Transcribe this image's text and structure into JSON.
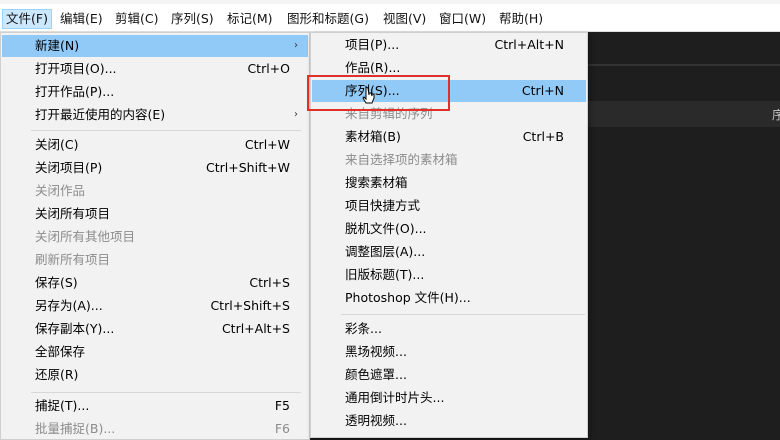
{
  "menubar": {
    "items": [
      {
        "label": "文件(F)"
      },
      {
        "label": "编辑(E)"
      },
      {
        "label": "剪辑(C)"
      },
      {
        "label": "序列(S)"
      },
      {
        "label": "标记(M)"
      },
      {
        "label": "图形和标题(G)"
      },
      {
        "label": "视图(V)"
      },
      {
        "label": "窗口(W)"
      },
      {
        "label": "帮助(H)"
      }
    ]
  },
  "file_menu": {
    "items": [
      {
        "label": "新建(N)",
        "shortcut": "",
        "submenu_arrow": "›"
      },
      {
        "label": "打开项目(O)...",
        "shortcut": "Ctrl+O"
      },
      {
        "label": "打开作品(P)...",
        "shortcut": ""
      },
      {
        "label": "打开最近使用的内容(E)",
        "shortcut": "",
        "submenu_arrow": "›"
      },
      {
        "label": "关闭(C)",
        "shortcut": "Ctrl+W"
      },
      {
        "label": "关闭项目(P)",
        "shortcut": "Ctrl+Shift+W"
      },
      {
        "label": "关闭作品",
        "shortcut": ""
      },
      {
        "label": "关闭所有项目",
        "shortcut": ""
      },
      {
        "label": "关闭所有其他项目",
        "shortcut": ""
      },
      {
        "label": "刷新所有项目",
        "shortcut": ""
      },
      {
        "label": "保存(S)",
        "shortcut": "Ctrl+S"
      },
      {
        "label": "另存为(A)...",
        "shortcut": "Ctrl+Shift+S"
      },
      {
        "label": "保存副本(Y)...",
        "shortcut": "Ctrl+Alt+S"
      },
      {
        "label": "全部保存",
        "shortcut": ""
      },
      {
        "label": "还原(R)",
        "shortcut": ""
      },
      {
        "label": "捕捉(T)...",
        "shortcut": "F5"
      },
      {
        "label": "批量捕捉(B)...",
        "shortcut": "F6"
      }
    ]
  },
  "new_submenu": {
    "items": [
      {
        "label": "项目(P)...",
        "shortcut": "Ctrl+Alt+N"
      },
      {
        "label": "作品(R)...",
        "shortcut": ""
      },
      {
        "label": "序列(S)...",
        "shortcut": "Ctrl+N"
      },
      {
        "label": "来自剪辑的序列",
        "shortcut": ""
      },
      {
        "label": "素材箱(B)",
        "shortcut": "Ctrl+B"
      },
      {
        "label": "来自选择项的素材箱",
        "shortcut": ""
      },
      {
        "label": "搜索素材箱",
        "shortcut": ""
      },
      {
        "label": "项目快捷方式",
        "shortcut": ""
      },
      {
        "label": "脱机文件(O)...",
        "shortcut": ""
      },
      {
        "label": "调整图层(A)...",
        "shortcut": ""
      },
      {
        "label": "旧版标题(T)...",
        "shortcut": ""
      },
      {
        "label": "Photoshop 文件(H)...",
        "shortcut": ""
      },
      {
        "label": "彩条...",
        "shortcut": ""
      },
      {
        "label": "黑场视频...",
        "shortcut": ""
      },
      {
        "label": "颜色遮罩...",
        "shortcut": ""
      },
      {
        "label": "通用倒计时片头...",
        "shortcut": ""
      },
      {
        "label": "透明视频...",
        "shortcut": ""
      }
    ]
  },
  "background_panel": {
    "label": "序"
  },
  "colors": {
    "highlight": "#91c9f7",
    "annotation": "#e0302b",
    "menu_bg": "#f2f2f2",
    "disabled_text": "#8c8c8c"
  }
}
